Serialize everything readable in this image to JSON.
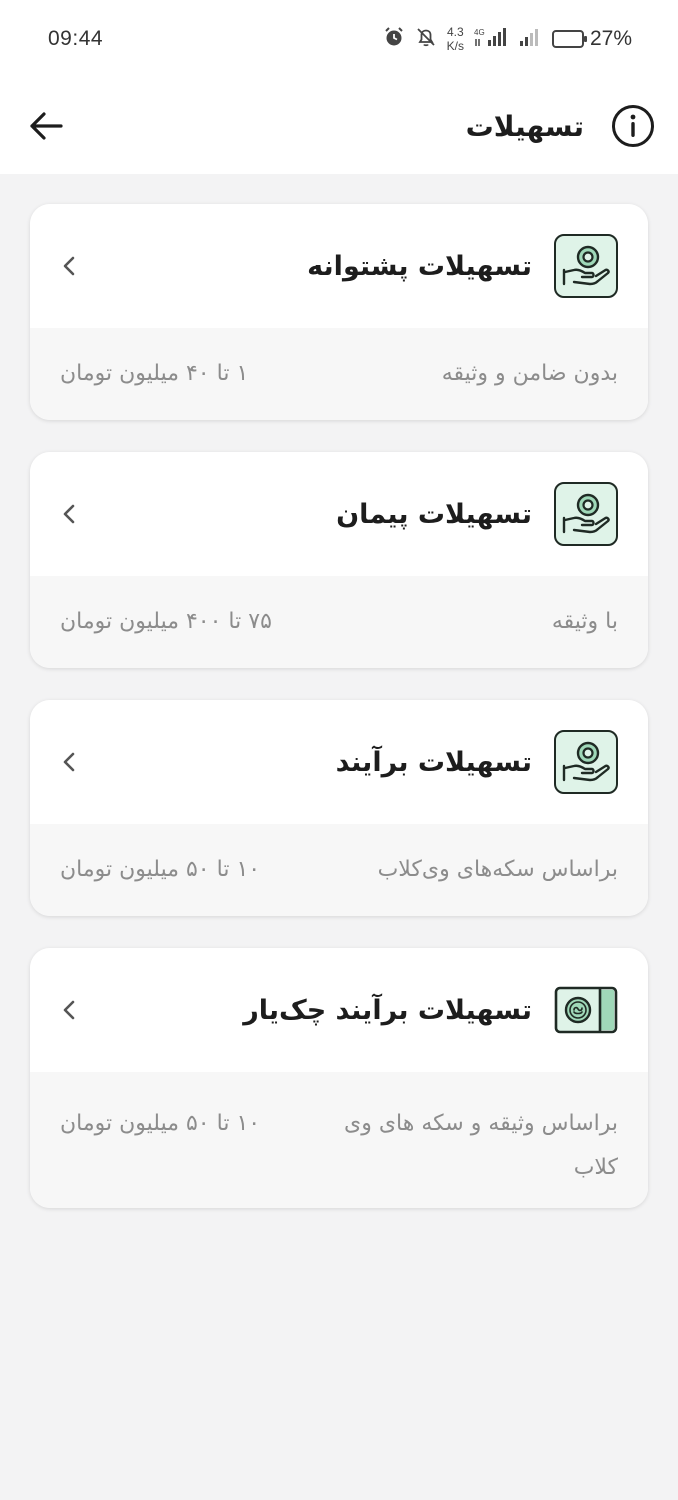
{
  "status_bar": {
    "time": "09:44",
    "net_speed_value": "4.3",
    "net_speed_unit": "K/s",
    "battery_percent": "27%",
    "battery_level": 0.27,
    "icons": [
      "alarm-icon",
      "mute-bell-icon",
      "signal-4g-icon",
      "signal-icon",
      "battery-icon"
    ]
  },
  "app_bar": {
    "title": "تسهیلات",
    "back_icon": "arrow-left-icon",
    "info_icon": "info-icon"
  },
  "facilities": [
    {
      "title": "تسهیلات پشتوانه",
      "description": "بدون ضامن و وثیقه",
      "amount": "۱ تا ۴۰ میلیون تومان",
      "icon": "hand-coin-icon"
    },
    {
      "title": "تسهیلات پیمان",
      "description": "با وثیقه",
      "amount": "۷۵ تا ۴۰۰ میلیون تومان",
      "icon": "hand-coin-icon"
    },
    {
      "title": "تسهیلات برآیند",
      "description": "براساس سکه‌های وی‌کلاب",
      "amount": "۱۰ تا ۵۰ میلیون تومان",
      "icon": "hand-coin-icon"
    },
    {
      "title": "تسهیلات برآیند چک‌یار",
      "description": "براساس وثیقه و سکه های وی کلاب",
      "amount": "۱۰ تا ۵۰ میلیون تومان",
      "icon": "cheque-coin-icon"
    }
  ],
  "colors": {
    "icon_fill": "#dff3e8",
    "icon_accent": "#1f8f5c",
    "text_muted": "#8c8c8c"
  }
}
